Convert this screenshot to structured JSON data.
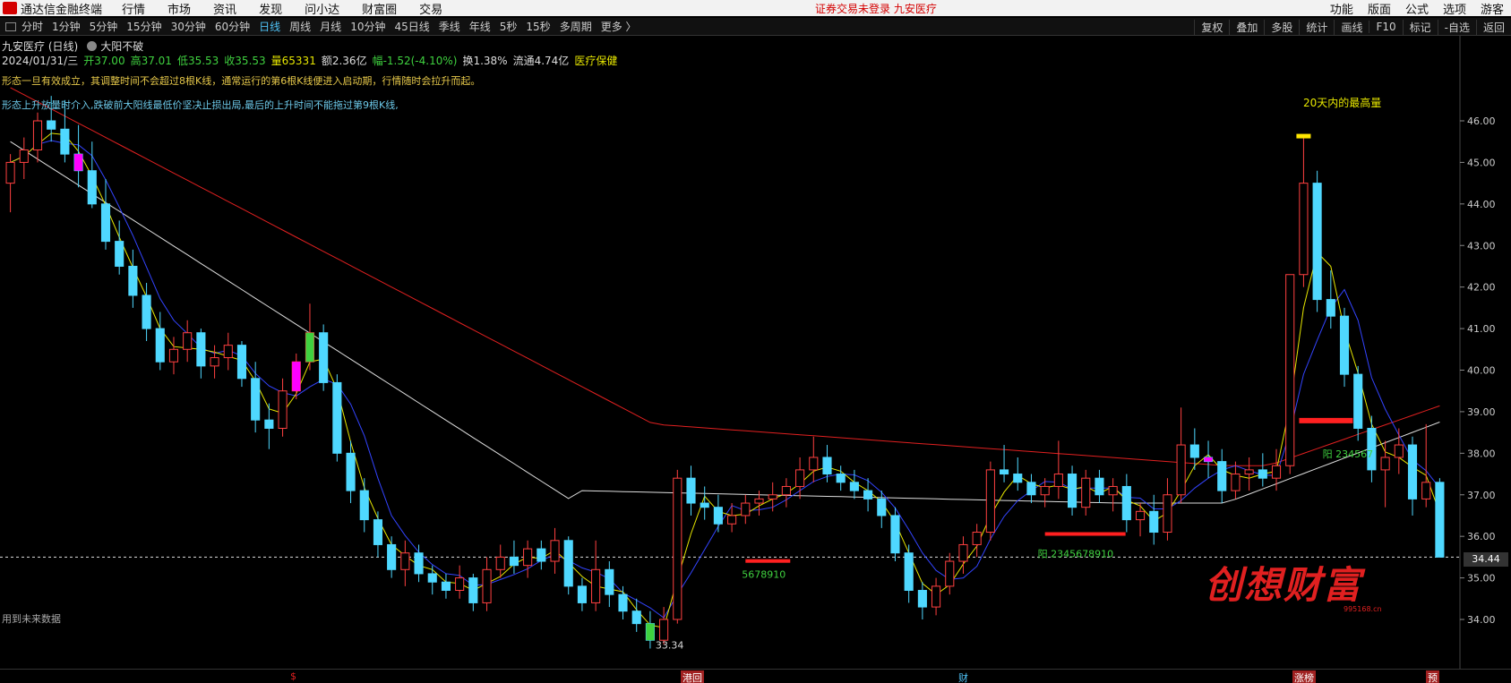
{
  "titlebar": {
    "app_title": "通达信金融终端",
    "menu": [
      "行情",
      "市场",
      "资讯",
      "发现",
      "问小达",
      "财富圈",
      "交易"
    ],
    "notice": "证券交易未登录 九安医疗",
    "right": [
      "功能",
      "版面",
      "公式",
      "选项",
      "游客"
    ]
  },
  "toolbar": {
    "periods": [
      "分时",
      "1分钟",
      "5分钟",
      "15分钟",
      "30分钟",
      "60分钟",
      "日线",
      "周线",
      "月线",
      "10分钟",
      "45日线",
      "季线",
      "年线",
      "5秒",
      "15秒",
      "多周期",
      "更多 〉"
    ],
    "active": "日线",
    "right": [
      "复权",
      "叠加",
      "多股",
      "统计",
      "画线",
      "F10",
      "标记",
      "-自选",
      "返回"
    ]
  },
  "info": {
    "stock": "九安医疗 (日线)",
    "strategy": "大阳不破",
    "date": "2024/01/31/三",
    "open": "开37.00",
    "high": "高37.01",
    "low": "低35.53",
    "close": "收35.53",
    "volume": "量65331",
    "amount": "额2.36亿",
    "change": "幅-1.52(-4.10%)",
    "turnover": "换1.38%",
    "float_cap": "流通4.74亿",
    "sector": "医疗保健"
  },
  "patterns": {
    "line1": "形态一旦有效成立，其调整时间不会超过8根K线，通常运行的第6根K线便进入启动期，行情随时会拉升而起。",
    "line2": "形态上升放量时介入,跌破前大阳线最低价坚决止损出局,最后的上升时间不能拖过第9根K线,"
  },
  "annotations": {
    "peak_label": "20天内的最高量",
    "low_price": "33.34",
    "price_now": "34.44",
    "future_note": "用到未来数据",
    "seq1": "5678910",
    "seq2": "阳 2345678910",
    "seq3": "阳 234567"
  },
  "watermark": {
    "text": "创想财富",
    "url": "995168.cn"
  },
  "bottom_marks": [
    "$",
    "港回",
    "财",
    "涨榜",
    "预"
  ],
  "chart_data": {
    "type": "candlestick",
    "ylim": [
      33.5,
      46.5
    ],
    "yticks": [
      34.0,
      35.0,
      36.0,
      37.0,
      38.0,
      39.0,
      40.0,
      41.0,
      42.0,
      43.0,
      44.0,
      45.0,
      46.0
    ],
    "grid": false,
    "candles": [
      [
        44.5,
        45.2,
        43.8,
        45.0
      ],
      [
        45.0,
        45.6,
        44.6,
        45.3
      ],
      [
        45.3,
        46.2,
        45.0,
        46.0
      ],
      [
        46.0,
        46.6,
        45.5,
        45.8
      ],
      [
        45.8,
        46.5,
        45.0,
        45.2
      ],
      [
        45.2,
        45.9,
        44.4,
        44.8
      ],
      [
        44.8,
        45.5,
        43.9,
        44.0
      ],
      [
        44.0,
        44.6,
        42.9,
        43.1
      ],
      [
        43.1,
        43.6,
        42.3,
        42.5
      ],
      [
        42.5,
        42.9,
        41.5,
        41.8
      ],
      [
        41.8,
        42.1,
        40.7,
        41.0
      ],
      [
        41.0,
        41.4,
        40.0,
        40.2
      ],
      [
        40.2,
        40.8,
        39.9,
        40.5
      ],
      [
        40.5,
        41.2,
        40.2,
        40.9
      ],
      [
        40.9,
        41.0,
        39.8,
        40.1
      ],
      [
        40.1,
        40.6,
        39.8,
        40.3
      ],
      [
        40.3,
        40.9,
        40.0,
        40.6
      ],
      [
        40.6,
        40.7,
        39.6,
        39.8
      ],
      [
        39.8,
        40.2,
        38.5,
        38.8
      ],
      [
        38.8,
        39.2,
        38.1,
        38.6
      ],
      [
        38.6,
        39.8,
        38.4,
        39.5
      ],
      [
        39.5,
        40.4,
        39.3,
        40.2
      ],
      [
        40.2,
        41.6,
        40.0,
        40.9
      ],
      [
        40.9,
        41.1,
        39.5,
        39.7
      ],
      [
        39.7,
        39.9,
        37.8,
        38.0
      ],
      [
        38.0,
        38.3,
        36.8,
        37.1
      ],
      [
        37.1,
        37.4,
        36.1,
        36.4
      ],
      [
        36.4,
        36.6,
        35.5,
        35.8
      ],
      [
        35.8,
        36.0,
        35.0,
        35.2
      ],
      [
        35.2,
        35.9,
        34.8,
        35.6
      ],
      [
        35.6,
        35.8,
        34.9,
        35.1
      ],
      [
        35.1,
        35.3,
        34.6,
        34.9
      ],
      [
        34.9,
        35.1,
        34.5,
        34.7
      ],
      [
        34.7,
        35.3,
        34.5,
        35.0
      ],
      [
        35.0,
        35.1,
        34.2,
        34.4
      ],
      [
        34.4,
        35.5,
        34.2,
        35.2
      ],
      [
        35.2,
        35.8,
        35.0,
        35.5
      ],
      [
        35.5,
        35.9,
        35.1,
        35.3
      ],
      [
        35.3,
        35.9,
        35.0,
        35.7
      ],
      [
        35.7,
        35.9,
        35.2,
        35.4
      ],
      [
        35.4,
        36.2,
        35.1,
        35.9
      ],
      [
        35.9,
        36.0,
        34.6,
        34.8
      ],
      [
        34.8,
        35.0,
        34.2,
        34.4
      ],
      [
        34.4,
        35.9,
        34.2,
        35.2
      ],
      [
        35.2,
        35.4,
        34.3,
        34.6
      ],
      [
        34.6,
        34.8,
        34.0,
        34.2
      ],
      [
        34.2,
        34.5,
        33.7,
        33.9
      ],
      [
        33.9,
        34.2,
        33.3,
        33.5
      ],
      [
        33.5,
        34.3,
        33.4,
        34.0
      ],
      [
        34.0,
        37.6,
        33.9,
        37.4
      ],
      [
        37.4,
        37.7,
        36.5,
        36.8
      ],
      [
        36.8,
        37.2,
        36.4,
        36.7
      ],
      [
        36.7,
        37.0,
        36.1,
        36.3
      ],
      [
        36.3,
        36.8,
        36.1,
        36.5
      ],
      [
        36.5,
        37.0,
        36.3,
        36.8
      ],
      [
        36.8,
        37.1,
        36.5,
        36.9
      ],
      [
        36.9,
        37.3,
        36.6,
        37.0
      ],
      [
        37.0,
        37.4,
        36.7,
        37.2
      ],
      [
        37.2,
        37.9,
        36.9,
        37.6
      ],
      [
        37.6,
        38.4,
        37.3,
        37.9
      ],
      [
        37.9,
        38.2,
        37.3,
        37.5
      ],
      [
        37.5,
        37.7,
        37.1,
        37.3
      ],
      [
        37.3,
        37.6,
        36.9,
        37.1
      ],
      [
        37.1,
        37.4,
        36.6,
        36.9
      ],
      [
        36.9,
        37.1,
        36.2,
        36.5
      ],
      [
        36.5,
        36.7,
        35.4,
        35.6
      ],
      [
        35.6,
        35.8,
        34.4,
        34.7
      ],
      [
        34.7,
        34.9,
        34.0,
        34.3
      ],
      [
        34.3,
        35.0,
        34.1,
        34.8
      ],
      [
        34.8,
        35.6,
        34.6,
        35.4
      ],
      [
        35.4,
        36.0,
        35.1,
        35.8
      ],
      [
        35.8,
        36.3,
        35.5,
        36.1
      ],
      [
        36.1,
        37.8,
        35.9,
        37.6
      ],
      [
        37.6,
        38.2,
        37.3,
        37.5
      ],
      [
        37.5,
        37.9,
        37.1,
        37.3
      ],
      [
        37.3,
        37.5,
        36.8,
        37.0
      ],
      [
        37.0,
        37.4,
        36.7,
        37.2
      ],
      [
        37.2,
        38.3,
        36.9,
        37.5
      ],
      [
        37.5,
        37.7,
        36.5,
        36.7
      ],
      [
        36.7,
        37.6,
        36.5,
        37.4
      ],
      [
        37.4,
        37.6,
        36.8,
        37.0
      ],
      [
        37.0,
        37.4,
        36.6,
        37.2
      ],
      [
        37.2,
        37.5,
        36.1,
        36.4
      ],
      [
        36.4,
        36.8,
        36.0,
        36.6
      ],
      [
        36.6,
        37.0,
        35.8,
        36.1
      ],
      [
        36.1,
        37.4,
        35.9,
        37.0
      ],
      [
        37.0,
        39.1,
        36.8,
        38.2
      ],
      [
        38.2,
        38.6,
        37.6,
        37.9
      ],
      [
        37.9,
        38.3,
        37.4,
        37.8
      ],
      [
        37.8,
        38.1,
        36.8,
        37.1
      ],
      [
        37.1,
        37.8,
        36.9,
        37.5
      ],
      [
        37.5,
        37.9,
        37.1,
        37.6
      ],
      [
        37.6,
        38.0,
        37.2,
        37.4
      ],
      [
        37.4,
        38.1,
        37.1,
        37.7
      ],
      [
        37.7,
        38.7,
        37.5,
        42.3
      ],
      [
        42.3,
        45.6,
        42.0,
        44.5
      ],
      [
        44.5,
        44.8,
        41.4,
        41.7
      ],
      [
        41.7,
        42.4,
        41.0,
        41.3
      ],
      [
        41.3,
        41.5,
        39.6,
        39.9
      ],
      [
        39.9,
        40.1,
        38.3,
        38.6
      ],
      [
        38.6,
        38.9,
        37.3,
        37.6
      ],
      [
        37.6,
        38.3,
        36.7,
        37.9
      ],
      [
        37.9,
        38.6,
        37.5,
        38.2
      ],
      [
        38.2,
        38.4,
        36.5,
        36.9
      ],
      [
        36.9,
        38.7,
        36.7,
        37.3
      ],
      [
        37.3,
        37.4,
        35.5,
        35.5
      ]
    ],
    "ma_short_color": "#e6e600",
    "ma_mid_color": "#3344ff",
    "ma_long1_color": "#e02020",
    "ma_long2_color": "#dddddd",
    "up_color": "#ff4040",
    "down_color": "#4fd8ff"
  }
}
